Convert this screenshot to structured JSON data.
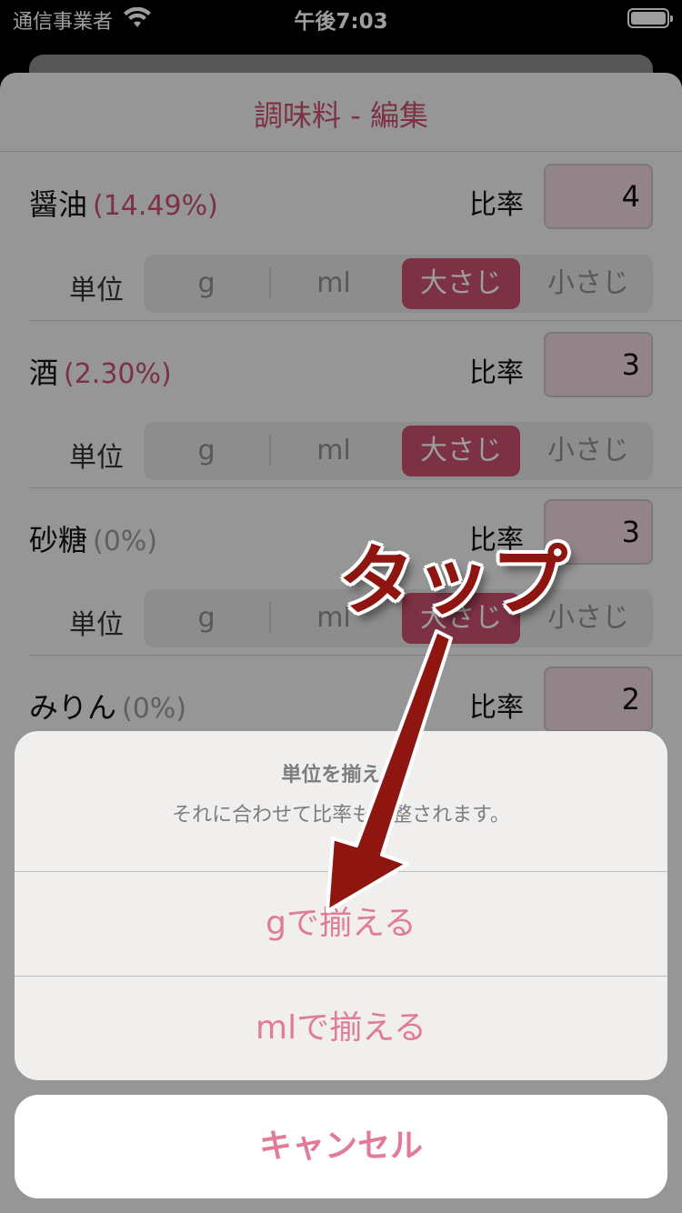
{
  "status_bar": {
    "carrier": "通信事業者",
    "time": "午後7:03"
  },
  "nav": {
    "title": "調味料 - 編集"
  },
  "ratio_label": "比率",
  "unit_label": "単位",
  "unit_options": [
    "g",
    "ml",
    "大さじ",
    "小さじ"
  ],
  "ingredients": [
    {
      "name": "醤油",
      "percent": "(14.49%)",
      "ratio": "4",
      "selected_unit": "大さじ"
    },
    {
      "name": "酒",
      "percent": "(2.30%)",
      "ratio": "3",
      "selected_unit": "大さじ"
    },
    {
      "name": "砂糖",
      "percent": "(0%)",
      "ratio": "3",
      "selected_unit": "大さじ"
    },
    {
      "name": "みりん",
      "percent": "(0%)",
      "ratio": "2",
      "selected_unit": ""
    }
  ],
  "action_sheet": {
    "title": "単位を揃える",
    "message": "それに合わせて比率も調整されます。",
    "actions": [
      "gで揃える",
      "mlで揃える"
    ],
    "cancel": "キャンセル"
  },
  "annotation": {
    "text": "タップ",
    "color": "#8e1510"
  },
  "colors": {
    "accent": "#c8506f",
    "action_text": "#e07b98"
  }
}
